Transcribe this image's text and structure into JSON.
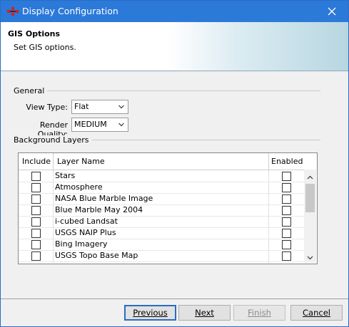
{
  "window": {
    "title": "Display Configuration"
  },
  "banner": {
    "title": "GIS Options",
    "subtitle": "Set GIS options."
  },
  "general": {
    "group_label": "General",
    "view_type_label": "View Type:",
    "view_type_value": "Flat",
    "render_quality_label": "Render Quality:",
    "render_quality_value": "MEDIUM"
  },
  "background_layers": {
    "group_label": "Background Layers",
    "columns": [
      "Include",
      "Layer Name",
      "Enabled"
    ],
    "rows": [
      {
        "name": "Stars",
        "include": false,
        "enabled": false
      },
      {
        "name": "Atmosphere",
        "include": false,
        "enabled": false
      },
      {
        "name": "NASA Blue Marble Image",
        "include": false,
        "enabled": false
      },
      {
        "name": "Blue Marble May 2004",
        "include": false,
        "enabled": false
      },
      {
        "name": "i-cubed Landsat",
        "include": false,
        "enabled": false
      },
      {
        "name": "USGS NAIP Plus",
        "include": false,
        "enabled": false
      },
      {
        "name": "Bing Imagery",
        "include": false,
        "enabled": false
      },
      {
        "name": "USGS Topo Base Map",
        "include": false,
        "enabled": false
      }
    ]
  },
  "buttons": {
    "previous": "Previous",
    "next": "Next",
    "finish": "Finish",
    "cancel": "Cancel"
  }
}
